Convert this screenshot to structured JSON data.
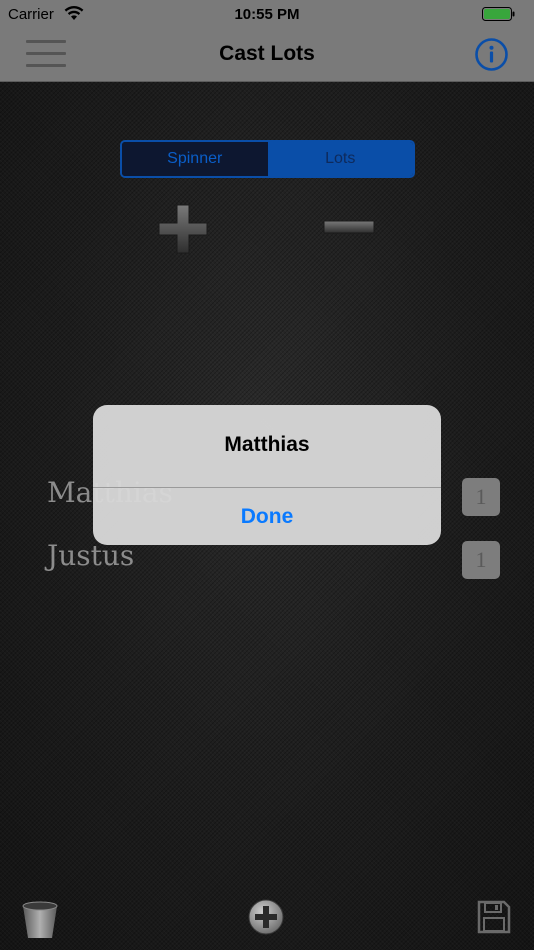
{
  "status_bar": {
    "carrier": "Carrier",
    "time": "10:55 PM"
  },
  "nav": {
    "title": "Cast Lots",
    "menu_icon": "hamburger-menu-icon",
    "info_icon": "info-circle-icon"
  },
  "mode_selector": {
    "options": [
      "Spinner",
      "Lots"
    ],
    "selected": "Lots"
  },
  "controls": {
    "add_icon": "plus-icon",
    "remove_icon": "minus-icon"
  },
  "lots": [
    {
      "name": "Matthias",
      "count": "1"
    },
    {
      "name": "Justus",
      "count": "1"
    }
  ],
  "alert": {
    "title": "Matthias",
    "button": "Done"
  },
  "toolbar": {
    "trash_icon": "bucket-icon",
    "add_icon": "add-circle-icon",
    "save_icon": "floppy-disk-icon"
  },
  "colors": {
    "accent": "#0a7aff",
    "segment_selected": "#0a4ea8",
    "background": "#1c1c1c"
  }
}
